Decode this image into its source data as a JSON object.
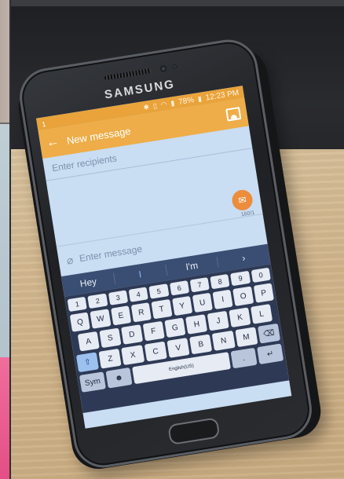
{
  "phone": {
    "brand": "SAMSUNG"
  },
  "status_bar": {
    "time": "12:23 PM",
    "battery": "78%"
  },
  "app_bar": {
    "notification_count": "1",
    "title": "New message"
  },
  "recipients": {
    "placeholder": "Enter recipients"
  },
  "composer": {
    "placeholder": "Enter message",
    "char_counter": "160/1"
  },
  "suggestions": [
    "Hey",
    "I",
    "I'm"
  ],
  "keyboard": {
    "number_row": [
      "1",
      "2",
      "3",
      "4",
      "5",
      "6",
      "7",
      "8",
      "9",
      "0"
    ],
    "row1": [
      "Q",
      "W",
      "E",
      "R",
      "T",
      "Y",
      "U",
      "I",
      "O",
      "P"
    ],
    "row2": [
      "A",
      "S",
      "D",
      "F",
      "G",
      "H",
      "J",
      "K",
      "L"
    ],
    "row3": [
      "Z",
      "X",
      "C",
      "V",
      "B",
      "N",
      "M"
    ],
    "sym_label": "Sym",
    "space_label": "English(US)",
    "period_label": "."
  }
}
